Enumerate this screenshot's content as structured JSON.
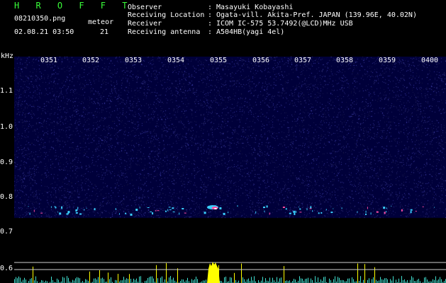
{
  "header": {
    "brand": "H R O F F T",
    "filename": "08210350.png",
    "datetime": "02.08.21 03:50",
    "meteor_label": "meteor",
    "meteor_count": "21"
  },
  "info": [
    {
      "label": "Observer",
      "value": "Masayuki Kobayashi"
    },
    {
      "label": "Receiving Location",
      "value": "Ogata-vill. Akita-Pref. JAPAN (139.96E, 40.02N)"
    },
    {
      "label": "Receiver",
      "value": "ICOM IC-575 53.7492(@LCD)MHz USB"
    },
    {
      "label": "Receiving antenna",
      "value": "A504HB(yagi 4el)"
    }
  ],
  "info_colon": ":",
  "time_axis": [
    "0351",
    "0352",
    "0353",
    "0354",
    "0355",
    "0356",
    "0357",
    "0358",
    "0359",
    "0400"
  ],
  "freq_axis": {
    "unit": "kHz",
    "labels": [
      "1.1",
      "1.0",
      "0.9",
      "0.8",
      "0.7",
      "0.6"
    ]
  },
  "colors": {
    "background": "#000000",
    "spectrum_bg": "#00003a",
    "brand": "#3aff3a",
    "echo_cyan": "#3ad0ff",
    "echo_hot": "#ff4aa0",
    "level_yellow": "#ffff00",
    "level_cyan": "#40e0d0"
  }
}
